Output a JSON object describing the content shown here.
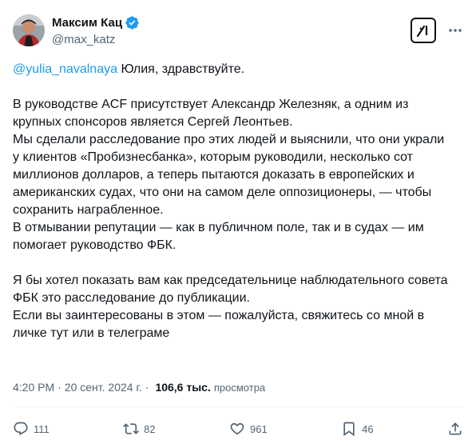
{
  "author": {
    "name": "Максим Кац",
    "handle": "@max_katz"
  },
  "post": {
    "mention": "@yulia_navalnaya",
    "greeting": " Юлия, здравствуйте.",
    "lines_block1": [
      "В руководстве ACF присутствует Александр Железняк, а одним из",
      "крупных спонсоров является Сергей Леонтьев.",
      "Мы сделали расследование про этих людей и выяснили, что они украли",
      "у клиентов «Пробизнесбанка», которым руководили, несколько сот",
      "миллионов долларов, а теперь пытаются доказать в европейских и",
      "американских судах, что они на самом деле оппозиционеры, — чтобы",
      "сохранить награбленное.",
      "В отмывании репутации — как в публичном поле, так и в судах — им",
      "помогает руководство ФБК."
    ],
    "lines_block2": [
      "Я бы хотел показать вам как председательнице наблюдательного совета",
      "ФБК это расследование до публикации.",
      "Если вы заинтересованы в этом — пожалуйста, свяжитесь со мной в",
      "личке тут или в телеграме"
    ]
  },
  "meta": {
    "time": "4:20 PM",
    "separator": "·",
    "date": "20 сент. 2024 г.",
    "views_count": "106,6 тыс.",
    "views_label": "просмотра"
  },
  "actions": {
    "replies": "111",
    "reposts": "82",
    "likes": "961",
    "bookmarks": "46"
  },
  "colors": {
    "accent": "#1d9bf0",
    "text": "#0f1419",
    "muted": "#536471"
  },
  "icons": [
    "verified-badge-icon",
    "grok-icon",
    "more-icon",
    "reply-icon",
    "repost-icon",
    "like-icon",
    "bookmark-icon",
    "share-icon"
  ]
}
